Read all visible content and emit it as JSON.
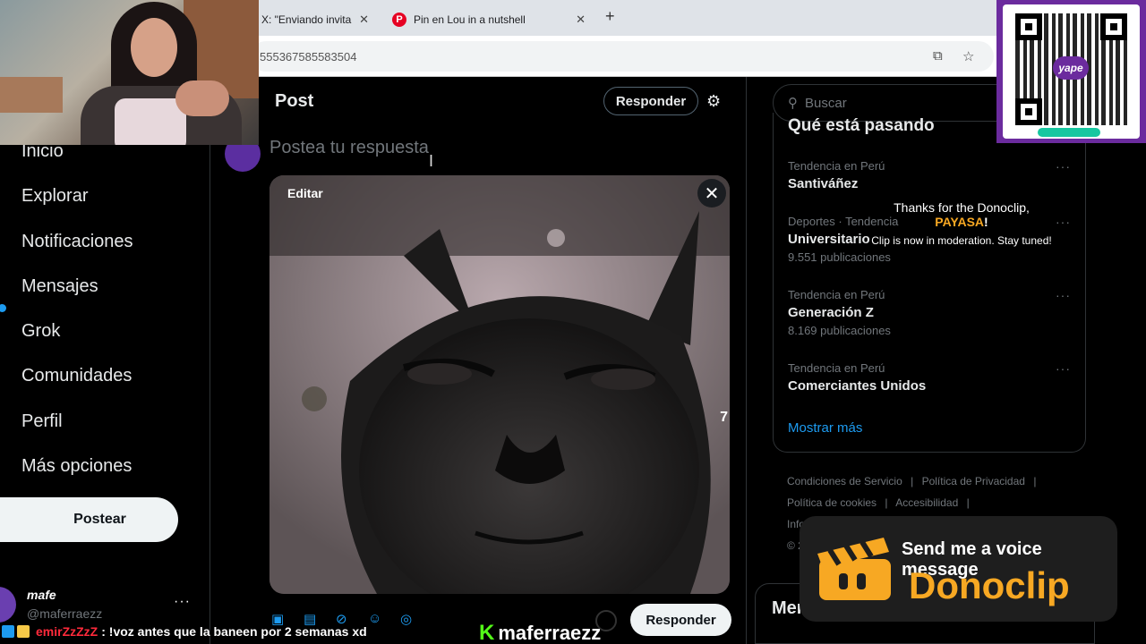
{
  "browser": {
    "tabs": [
      {
        "label": "X: \"Enviando invita",
        "close": "✕"
      },
      {
        "label": "Pin en Lou in a nutshell",
        "close": "✕"
      }
    ],
    "new_tab": "+",
    "url": "555367585583504",
    "pinterest_glyph": "P"
  },
  "leftnav": {
    "items": [
      "Inicio",
      "Explorar",
      "Notificaciones",
      "Mensajes",
      "Grok",
      "Comunidades",
      "Perfil",
      "Más opciones"
    ],
    "post_button": "Postear",
    "account": {
      "name": "mafe",
      "handle": "@maferraezz",
      "more": "···"
    }
  },
  "center": {
    "title": "Post",
    "reply_top": "Responder",
    "placeholder": "Postea tu respuesta",
    "media_edit": "Editar",
    "media_close": "✕",
    "media_side_number": "7",
    "reply_bottom": "Responder"
  },
  "right": {
    "search_placeholder": "Buscar",
    "trends_title": "Qué está pasando",
    "trends": [
      {
        "meta": "Tendencia en Perú",
        "name": "Santiváñez",
        "count": ""
      },
      {
        "meta": "Deportes · Tendencia",
        "name": "Universitario",
        "count": "9.551 publicaciones"
      },
      {
        "meta": "Tendencia en Perú",
        "name": "Generación Z",
        "count": "8.169 publicaciones"
      },
      {
        "meta": "Tendencia en Perú",
        "name": "Comerciantes Unidos",
        "count": ""
      }
    ],
    "show_more": "Mostrar más",
    "footer_links": [
      "Condiciones de Servicio",
      "|",
      "Política de Privacidad",
      "|",
      "Política de cookies",
      "|",
      "Accesibilidad",
      "|",
      "Inform"
    ],
    "footer_year": "© 2",
    "messages_title": "Mensajes"
  },
  "overlay": {
    "qr_logo": "yape",
    "dono_thanks": "Thanks for the Donoclip,",
    "dono_name": "PAYASA",
    "dono_bang": "!",
    "dono_moderation": "Clip is now in moderation. Stay tuned!",
    "dono_send": "Send me a voice message",
    "dono_brand": "Donoclip",
    "chat_user": "emirZzZzZ",
    "chat_sep": ":",
    "chat_message": "!voz antes que la baneen por 2 semanas xd",
    "kick_handle": "maferraezz",
    "kick_k": "K"
  },
  "colors": {
    "accent": "#1d9bf0",
    "donoclip": "#f7a823",
    "yape": "#6b2b9e",
    "kick": "#53fc18"
  }
}
